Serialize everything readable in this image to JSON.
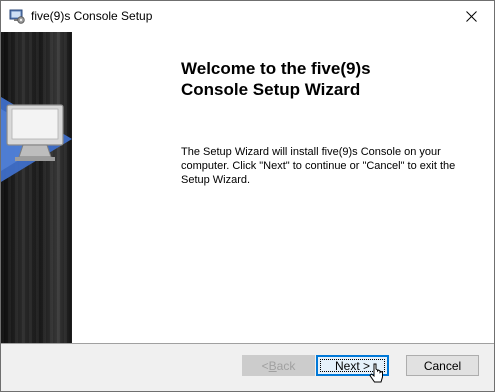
{
  "window": {
    "title": "five(9)s Console Setup",
    "close_glyph": "✕"
  },
  "banner": {
    "accent_color": "#4472c4"
  },
  "content": {
    "heading_line1": "Welcome to the five(9)s",
    "heading_line2": "Console Setup Wizard",
    "body_line1": "The Setup Wizard will install five(9)s Console on your",
    "body_line2": "computer.  Click \"Next\" to continue or \"Cancel\" to exit the",
    "body_line3": "Setup Wizard."
  },
  "footer": {
    "back_prefix": "< ",
    "back_underlined": "B",
    "back_rest": "ack",
    "next_label": "Next >",
    "cancel_label": "Cancel"
  }
}
